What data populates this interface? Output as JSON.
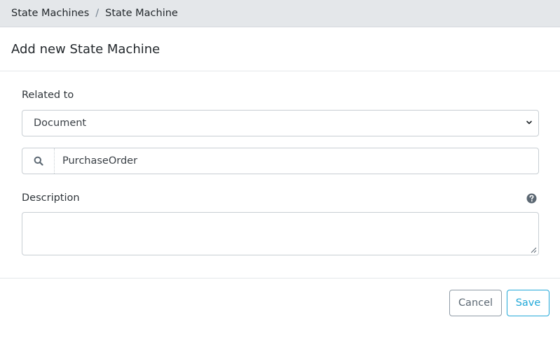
{
  "breadcrumb": {
    "items": [
      "State Machines",
      "State Machine"
    ],
    "separator": "/"
  },
  "header": {
    "title": "Add new State Machine"
  },
  "form": {
    "related_to": {
      "label": "Related to",
      "selected": "Document"
    },
    "search": {
      "value": "PurchaseOrder",
      "icon": "search-icon"
    },
    "description": {
      "label": "Description",
      "value": "",
      "help_icon": "question-circle-icon"
    }
  },
  "footer": {
    "cancel_label": "Cancel",
    "save_label": "Save"
  },
  "colors": {
    "primary": "#20a8d8",
    "breadcrumb_bg": "#e4e7ea",
    "border": "#c8ced3"
  }
}
